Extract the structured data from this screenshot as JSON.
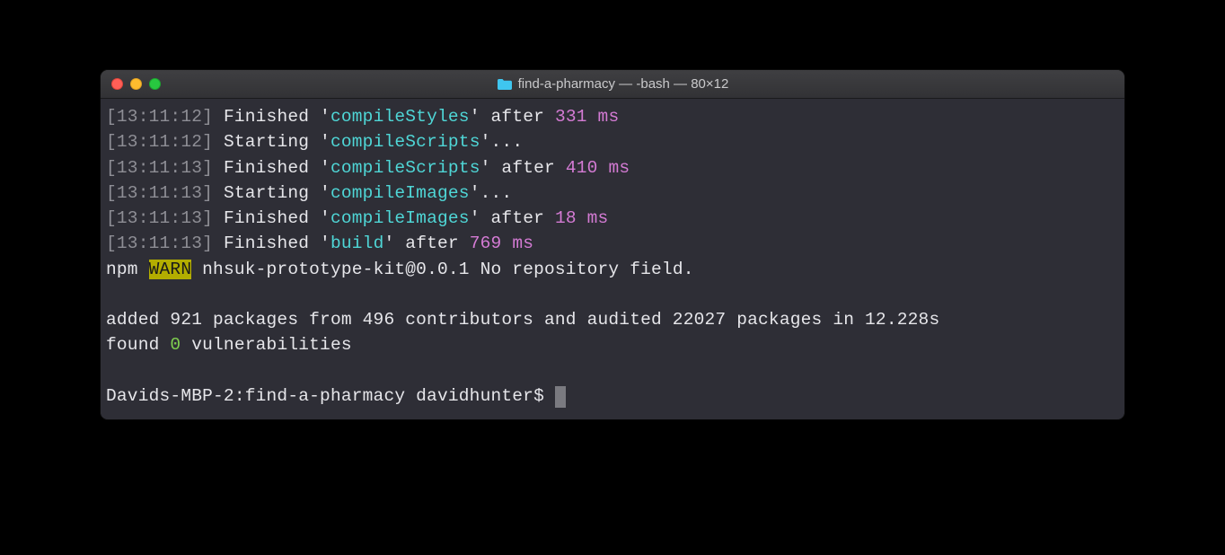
{
  "title": "find-a-pharmacy — -bash — 80×12",
  "lines": {
    "l1": {
      "time": "13:11:12",
      "action": "Finished",
      "task": "compileStyles",
      "after_label": "after",
      "duration": "331 ms"
    },
    "l2": {
      "time": "13:11:12",
      "action": "Starting",
      "task": "compileScripts",
      "suffix": "..."
    },
    "l3": {
      "time": "13:11:13",
      "action": "Finished",
      "task": "compileScripts",
      "after_label": "after",
      "duration": "410 ms"
    },
    "l4": {
      "time": "13:11:13",
      "action": "Starting",
      "task": "compileImages",
      "suffix": "..."
    },
    "l5": {
      "time": "13:11:13",
      "action": "Finished",
      "task": "compileImages",
      "after_label": "after",
      "duration": "18 ms"
    },
    "l6": {
      "time": "13:11:13",
      "action": "Finished",
      "task": "build",
      "after_label": "after",
      "duration": "769 ms"
    }
  },
  "npm": {
    "prefix": "npm",
    "warn_label": "WARN",
    "message": "nhsuk-prototype-kit@0.0.1 No repository field."
  },
  "added_line": "added 921 packages from 496 contributors and audited 22027 packages in 12.228s",
  "found_prefix": "found ",
  "found_count": "0",
  "found_suffix": " vulnerabilities",
  "prompt": "Davids-MBP-2:find-a-pharmacy davidhunter$ "
}
